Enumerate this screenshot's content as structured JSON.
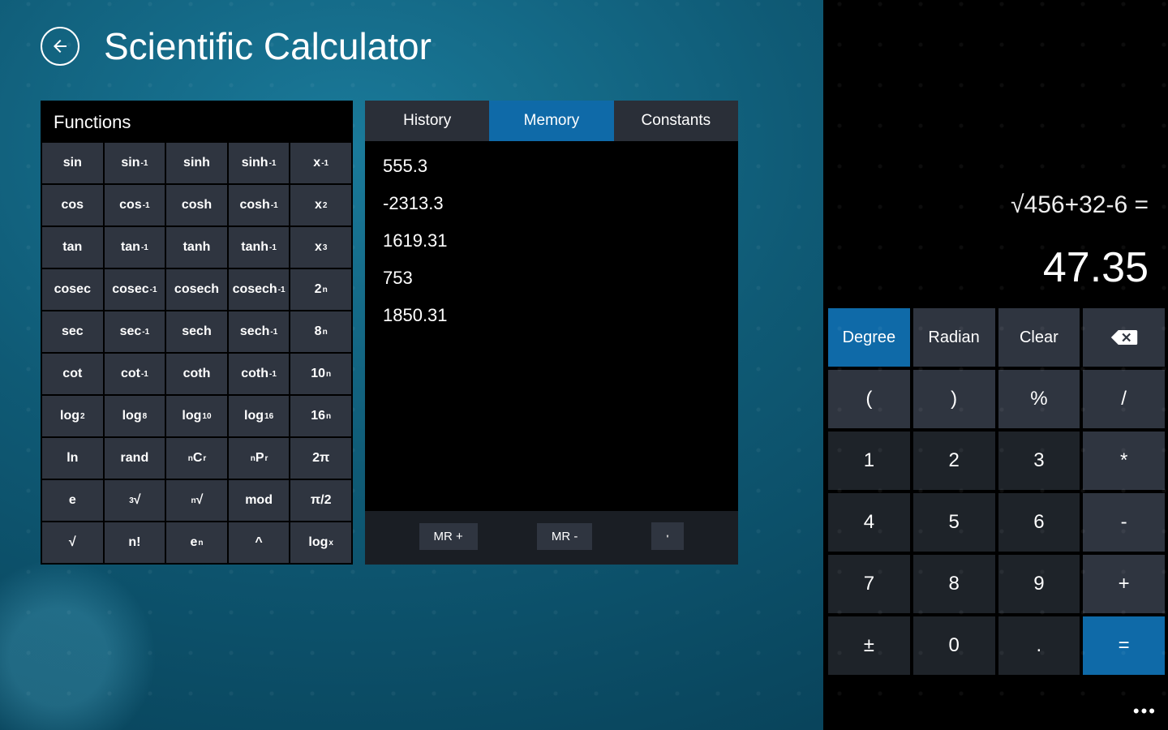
{
  "header": {
    "title": "Scientific Calculator"
  },
  "functions": {
    "title": "Functions",
    "rows": [
      [
        {
          "html": "sin",
          "name": "fn-sin"
        },
        {
          "html": "sin<sup>-1</sup>",
          "name": "fn-asin"
        },
        {
          "html": "sinh",
          "name": "fn-sinh"
        },
        {
          "html": "sinh<sup>-1</sup>",
          "name": "fn-asinh"
        },
        {
          "html": "x<sup>-1</sup>",
          "name": "fn-inverse"
        }
      ],
      [
        {
          "html": "cos",
          "name": "fn-cos"
        },
        {
          "html": "cos<sup>-1</sup>",
          "name": "fn-acos"
        },
        {
          "html": "cosh",
          "name": "fn-cosh"
        },
        {
          "html": "cosh<sup>-1</sup>",
          "name": "fn-acosh"
        },
        {
          "html": "x<sup>2</sup>",
          "name": "fn-square"
        }
      ],
      [
        {
          "html": "tan",
          "name": "fn-tan"
        },
        {
          "html": "tan<sup>-1</sup>",
          "name": "fn-atan"
        },
        {
          "html": "tanh",
          "name": "fn-tanh"
        },
        {
          "html": "tanh<sup>-1</sup>",
          "name": "fn-atanh"
        },
        {
          "html": "x<sup>3</sup>",
          "name": "fn-cube"
        }
      ],
      [
        {
          "html": "cosec",
          "name": "fn-cosec"
        },
        {
          "html": "cosec<sup>-1</sup>",
          "name": "fn-acosec"
        },
        {
          "html": "cosech",
          "name": "fn-cosech"
        },
        {
          "html": "cosech<sup>-1</sup>",
          "name": "fn-acosech"
        },
        {
          "html": "2<sup>n</sup>",
          "name": "fn-2n"
        }
      ],
      [
        {
          "html": "sec",
          "name": "fn-sec"
        },
        {
          "html": "sec<sup>-1</sup>",
          "name": "fn-asec"
        },
        {
          "html": "sech",
          "name": "fn-sech"
        },
        {
          "html": "sech<sup>-1</sup>",
          "name": "fn-asech"
        },
        {
          "html": "8<sup>n</sup>",
          "name": "fn-8n"
        }
      ],
      [
        {
          "html": "cot",
          "name": "fn-cot"
        },
        {
          "html": "cot<sup>-1</sup>",
          "name": "fn-acot"
        },
        {
          "html": "coth",
          "name": "fn-coth"
        },
        {
          "html": "coth<sup>-1</sup>",
          "name": "fn-acoth"
        },
        {
          "html": "10<sup>n</sup>",
          "name": "fn-10n"
        }
      ],
      [
        {
          "html": "log<sub>2</sub>",
          "name": "fn-log2"
        },
        {
          "html": "log<sub>8</sub>",
          "name": "fn-log8"
        },
        {
          "html": "log<sub>10</sub>",
          "name": "fn-log10"
        },
        {
          "html": "log<sub>16</sub>",
          "name": "fn-log16"
        },
        {
          "html": "16<sup>n</sup>",
          "name": "fn-16n"
        }
      ],
      [
        {
          "html": "ln",
          "name": "fn-ln"
        },
        {
          "html": "rand",
          "name": "fn-rand"
        },
        {
          "html": "<sup>n</sup>C<sub>r</sub>",
          "name": "fn-ncr"
        },
        {
          "html": "<sup>n</sup>P<sub>r</sub>",
          "name": "fn-npr"
        },
        {
          "html": "2π",
          "name": "fn-2pi"
        }
      ],
      [
        {
          "html": "e",
          "name": "fn-e"
        },
        {
          "html": "<sup>3</sup>√",
          "name": "fn-cbrt"
        },
        {
          "html": "<sup>n</sup>√",
          "name": "fn-nroot"
        },
        {
          "html": "mod",
          "name": "fn-mod"
        },
        {
          "html": "π/2",
          "name": "fn-pihalf"
        }
      ],
      [
        {
          "html": "√",
          "name": "fn-sqrt"
        },
        {
          "html": "n!",
          "name": "fn-fact"
        },
        {
          "html": "e<sup>n</sup>",
          "name": "fn-en"
        },
        {
          "html": "^",
          "name": "fn-pow"
        },
        {
          "html": "log<sub>x</sub>",
          "name": "fn-logx"
        }
      ]
    ]
  },
  "center_panel": {
    "tabs": [
      {
        "label": "History",
        "active": false,
        "name": "tab-history"
      },
      {
        "label": "Memory",
        "active": true,
        "name": "tab-memory"
      },
      {
        "label": "Constants",
        "active": false,
        "name": "tab-constants"
      }
    ],
    "memory": [
      "555.3",
      "-2313.3",
      "1619.31",
      "753",
      "1850.31"
    ],
    "actions": {
      "mr_plus": "MR +",
      "mr_minus": "MR -"
    }
  },
  "display": {
    "expression": "√456+32-6 =",
    "result": "47.35"
  },
  "keypad": [
    [
      {
        "label": "Degree",
        "name": "key-degree",
        "class": "small accent-blue"
      },
      {
        "label": "Radian",
        "name": "key-radian",
        "class": "small"
      },
      {
        "label": "Clear",
        "name": "key-clear",
        "class": "small"
      },
      {
        "label": "__BACKSPACE__",
        "name": "key-backspace",
        "class": ""
      }
    ],
    [
      {
        "label": "(",
        "name": "key-lparen",
        "class": ""
      },
      {
        "label": ")",
        "name": "key-rparen",
        "class": ""
      },
      {
        "label": "%",
        "name": "key-percent",
        "class": ""
      },
      {
        "label": "/",
        "name": "key-divide",
        "class": ""
      }
    ],
    [
      {
        "label": "1",
        "name": "key-1",
        "class": "num"
      },
      {
        "label": "2",
        "name": "key-2",
        "class": "num"
      },
      {
        "label": "3",
        "name": "key-3",
        "class": "num"
      },
      {
        "label": "*",
        "name": "key-multiply",
        "class": ""
      }
    ],
    [
      {
        "label": "4",
        "name": "key-4",
        "class": "num"
      },
      {
        "label": "5",
        "name": "key-5",
        "class": "num"
      },
      {
        "label": "6",
        "name": "key-6",
        "class": "num"
      },
      {
        "label": "-",
        "name": "key-minus",
        "class": ""
      }
    ],
    [
      {
        "label": "7",
        "name": "key-7",
        "class": "num"
      },
      {
        "label": "8",
        "name": "key-8",
        "class": "num"
      },
      {
        "label": "9",
        "name": "key-9",
        "class": "num"
      },
      {
        "label": "+",
        "name": "key-plus",
        "class": ""
      }
    ],
    [
      {
        "label": "±",
        "name": "key-negate",
        "class": "num"
      },
      {
        "label": "0",
        "name": "key-0",
        "class": "num"
      },
      {
        "label": ".",
        "name": "key-decimal",
        "class": "num"
      },
      {
        "label": "=",
        "name": "key-equals",
        "class": "accent-blue"
      }
    ]
  ]
}
